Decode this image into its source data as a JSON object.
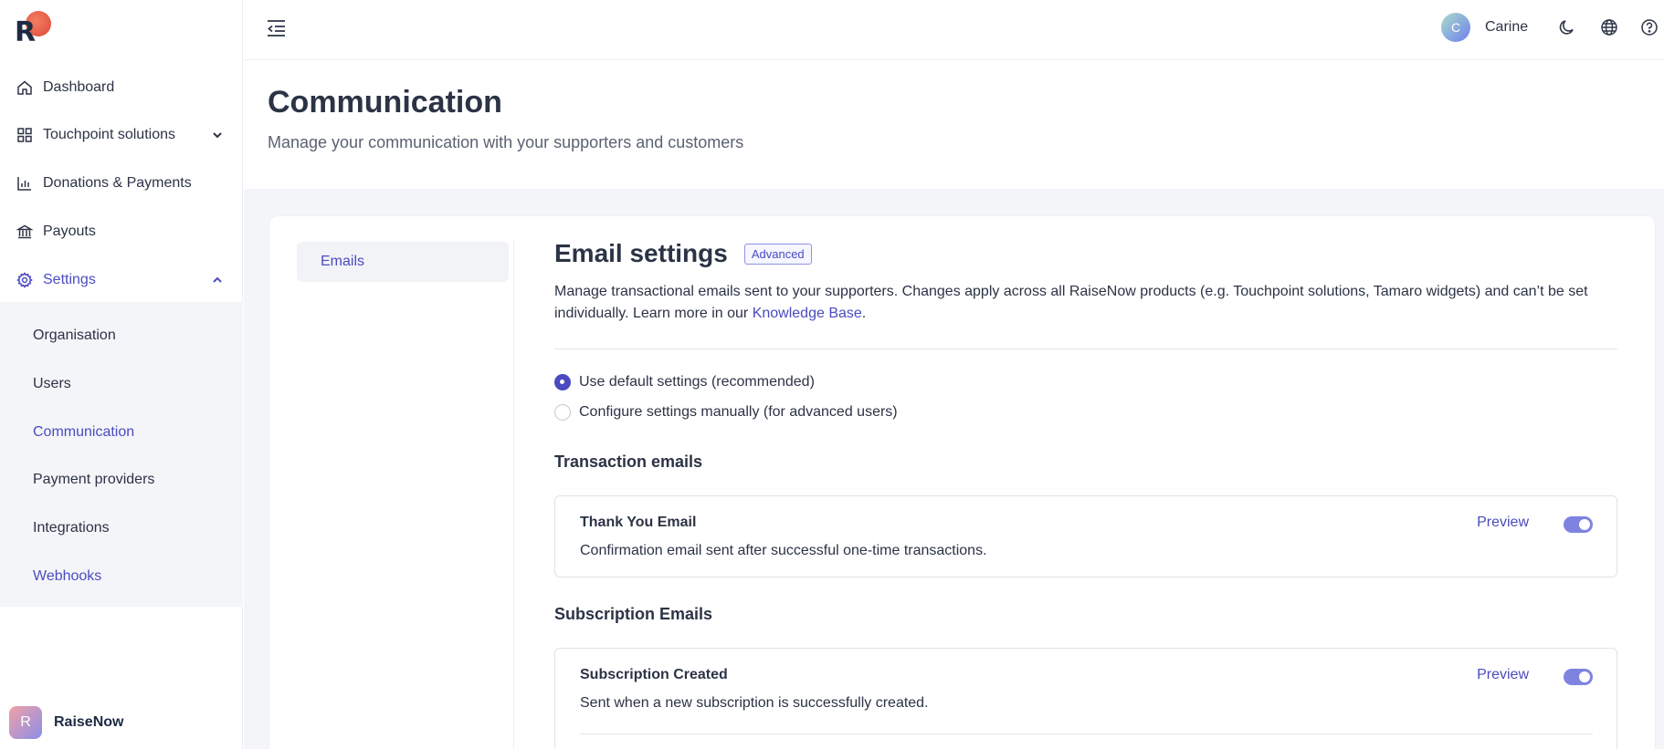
{
  "brand": {
    "logo_letter": "R",
    "org_initial": "R",
    "org_name": "RaiseNow"
  },
  "sidebar": {
    "items": [
      {
        "label": "Dashboard",
        "icon": "home-icon"
      },
      {
        "label": "Touchpoint solutions",
        "icon": "grid-icon"
      },
      {
        "label": "Donations & Payments",
        "icon": "bar-chart-icon"
      },
      {
        "label": "Payouts",
        "icon": "bank-icon"
      },
      {
        "label": "Settings",
        "icon": "gear-icon"
      }
    ],
    "settings_sub": [
      {
        "label": "Organisation"
      },
      {
        "label": "Users"
      },
      {
        "label": "Communication"
      },
      {
        "label": "Payment providers"
      },
      {
        "label": "Integrations"
      },
      {
        "label": "Webhooks"
      }
    ]
  },
  "topbar": {
    "user_initial": "C",
    "user_name": "Carine"
  },
  "header": {
    "title": "Communication",
    "subtitle": "Manage your communication with your supporters and customers"
  },
  "tabs": [
    {
      "label": "Emails"
    }
  ],
  "email_settings": {
    "title": "Email settings",
    "badge": "Advanced",
    "desc_part1": "Manage transactional emails sent to your supporters. Changes apply across all RaiseNow products (e.g. Touchpoint solutions, Tamaro widgets) and can’t be set individually. Learn more in our ",
    "desc_link": "Knowledge Base",
    "desc_end": ".",
    "radio_default": "Use default settings (recommended)",
    "radio_manual": "Configure settings manually (for advanced users)"
  },
  "transaction_emails": {
    "heading": "Transaction emails",
    "items": [
      {
        "title": "Thank You Email",
        "desc": "Confirmation email sent after successful one-time transactions.",
        "preview": "Preview",
        "enabled": true
      }
    ]
  },
  "subscription_emails": {
    "heading": "Subscription Emails",
    "items": [
      {
        "title": "Subscription Created",
        "desc": "Sent when a new subscription is successfully created.",
        "preview": "Preview",
        "enabled": true
      }
    ]
  },
  "colors": {
    "accent": "#4b4bbf",
    "toggle_on": "#7f83e0",
    "logo_dot": "#e0473c"
  }
}
